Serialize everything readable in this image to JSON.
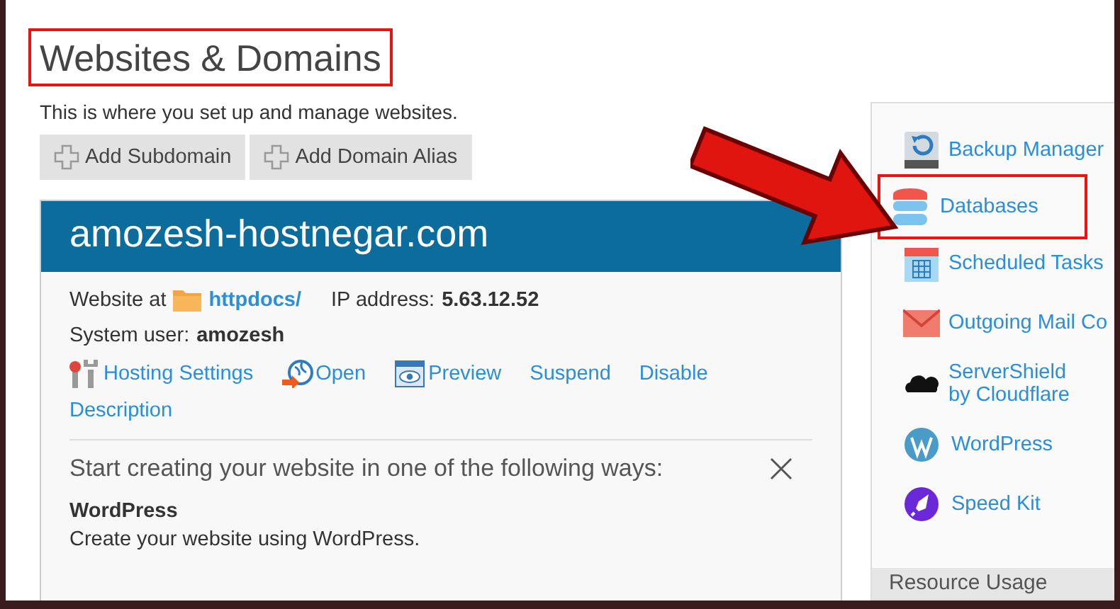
{
  "page": {
    "title": "Websites & Domains",
    "title_highlighted": true,
    "description": "This is where you set up and manage websites."
  },
  "toolbar": [
    {
      "label": "Add Subdomain"
    },
    {
      "label": "Add Domain Alias"
    }
  ],
  "domain": {
    "name": "amozesh-hostnegar.com",
    "website_at_label": "Website at",
    "folder": "httpdocs/",
    "ip_label": "IP address:",
    "ip": "5.63.12.52",
    "system_user_label": "System user:",
    "system_user": "amozesh",
    "actions": [
      {
        "label": "Hosting Settings",
        "kind": "tools"
      },
      {
        "label": "Open",
        "kind": "globe"
      },
      {
        "label": "Preview",
        "kind": "eye"
      },
      {
        "label": "Suspend",
        "kind": "plain"
      },
      {
        "label": "Disable",
        "kind": "plain"
      },
      {
        "label": "Description",
        "kind": "plain"
      }
    ]
  },
  "start": {
    "heading": "Start creating your website in one of the following ways:",
    "options": [
      {
        "title": "WordPress",
        "text": "Create your website using WordPress."
      }
    ]
  },
  "pointer_arrow": true,
  "sidebar": {
    "items": [
      {
        "label": "Backup Manager",
        "kind": "backup",
        "highlighted": false
      },
      {
        "label": "Databases",
        "kind": "database",
        "highlighted": true
      },
      {
        "label": "Scheduled Tasks",
        "kind": "calendar",
        "highlighted": false
      },
      {
        "label": "Outgoing Mail Co",
        "kind": "mail",
        "highlighted": false
      },
      {
        "label": "ServerShield by Cloudflare",
        "kind": "cloud",
        "highlighted": false
      },
      {
        "label": "WordPress",
        "kind": "wordpress",
        "highlighted": false
      },
      {
        "label": "Speed Kit",
        "kind": "rocket",
        "highlighted": false
      }
    ],
    "footer": "Resource Usage"
  }
}
